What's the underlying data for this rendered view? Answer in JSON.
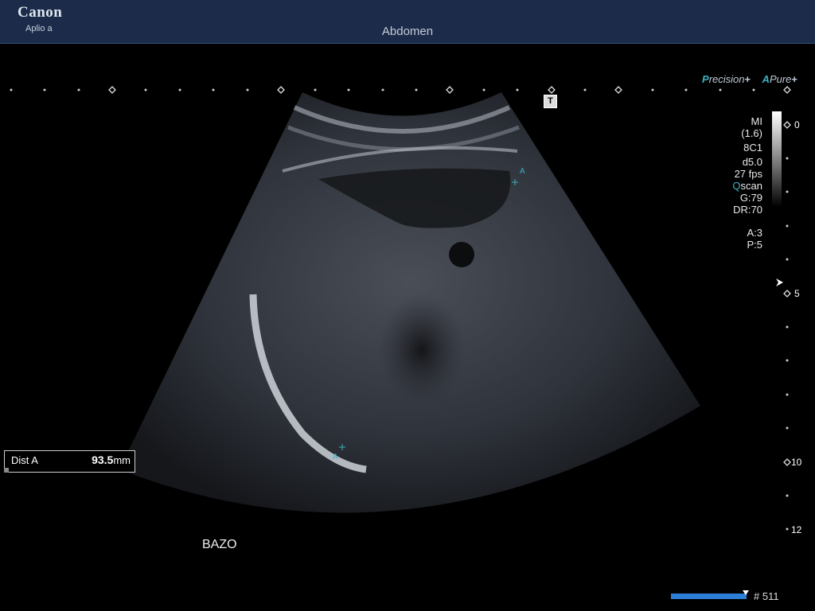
{
  "header": {
    "brand": "Canon",
    "model": "Aplio a",
    "preset": "Abdomen"
  },
  "modes": {
    "precision_letter": "P",
    "precision_rest": "recision",
    "pure_letter": "A",
    "pure_rest": "Pure",
    "plus": "+"
  },
  "t_marker": "T",
  "params": {
    "mi_label": "MI",
    "mi_value": "(1.6)",
    "probe": "8C1",
    "depth": "d5.0",
    "fps": "27 fps",
    "qscan_q": "Q",
    "qscan_rest": "scan",
    "gain": "G:79",
    "dynamic_range": "DR:70",
    "a_value": "A:3",
    "p_value": "P:5"
  },
  "depth_scale": {
    "labels": [
      "0",
      "5",
      "10",
      "12"
    ]
  },
  "caliper_labels": [
    "A",
    "A"
  ],
  "measurement": {
    "label": "Dist A",
    "value": "93.5",
    "unit": "mm"
  },
  "annotation": "BAZO",
  "cine": {
    "frame": "# 511"
  },
  "colors": {
    "header_bg": "#1b2b49",
    "accent_cyan": "#39b3c2",
    "cine_bar": "#2c7fd6"
  }
}
